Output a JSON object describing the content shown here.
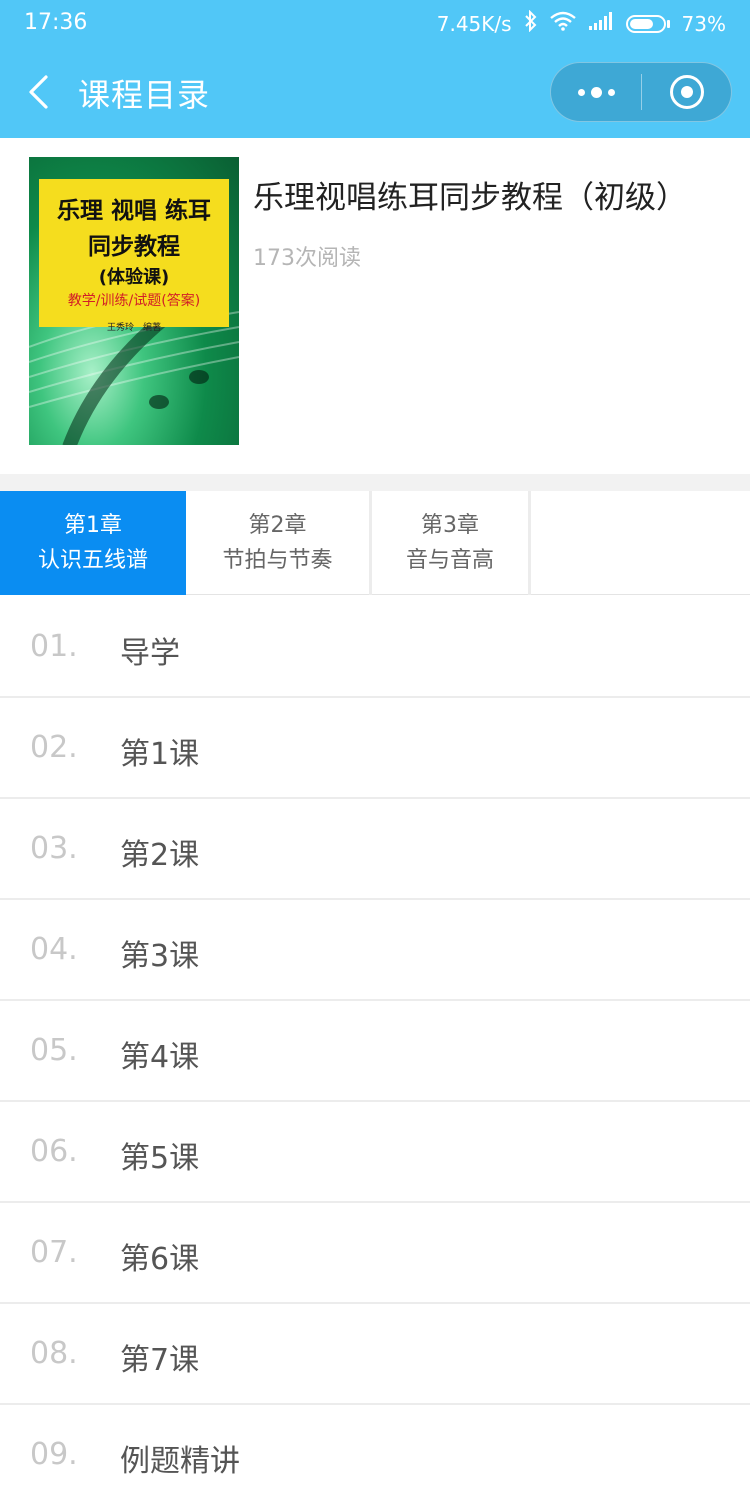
{
  "status_bar": {
    "time": "17:36",
    "network_speed": "7.45K/s",
    "battery": "73%",
    "battery_level": 0.73
  },
  "nav": {
    "title": "课程目录"
  },
  "course": {
    "title": "乐理视唱练耳同步教程（初级）",
    "reads": "173次阅读",
    "cover": {
      "line1": "乐理 视唱 练耳",
      "line2": "同步教程",
      "line3": "(体验课)",
      "line4": "教学/训练/试题(答案)",
      "line5": "王秀玲　编著"
    }
  },
  "tabs": [
    {
      "chapter": "第1章",
      "name": "认识五线谱",
      "active": true
    },
    {
      "chapter": "第2章",
      "name": "节拍与节奏",
      "active": false
    },
    {
      "chapter": "第3章",
      "name": "音与音高",
      "active": false
    }
  ],
  "lessons": [
    {
      "num": "01.",
      "title": "导学"
    },
    {
      "num": "02.",
      "title": "第1课"
    },
    {
      "num": "03.",
      "title": "第2课"
    },
    {
      "num": "04.",
      "title": "第3课"
    },
    {
      "num": "05.",
      "title": "第4课"
    },
    {
      "num": "06.",
      "title": "第5课"
    },
    {
      "num": "07.",
      "title": "第6课"
    },
    {
      "num": "08.",
      "title": "第7课"
    },
    {
      "num": "09.",
      "title": "例题精讲"
    }
  ],
  "colors": {
    "header_blue": "#51c7f7",
    "active_tab_blue": "#0a8df2",
    "cover_yellow": "#f5dd1e",
    "cover_green": "#0e8a4a"
  },
  "icons": [
    "bluetooth-icon",
    "wifi-icon",
    "signal-icon",
    "battery-icon",
    "back-arrow-icon",
    "more-icon",
    "close-target-icon"
  ]
}
